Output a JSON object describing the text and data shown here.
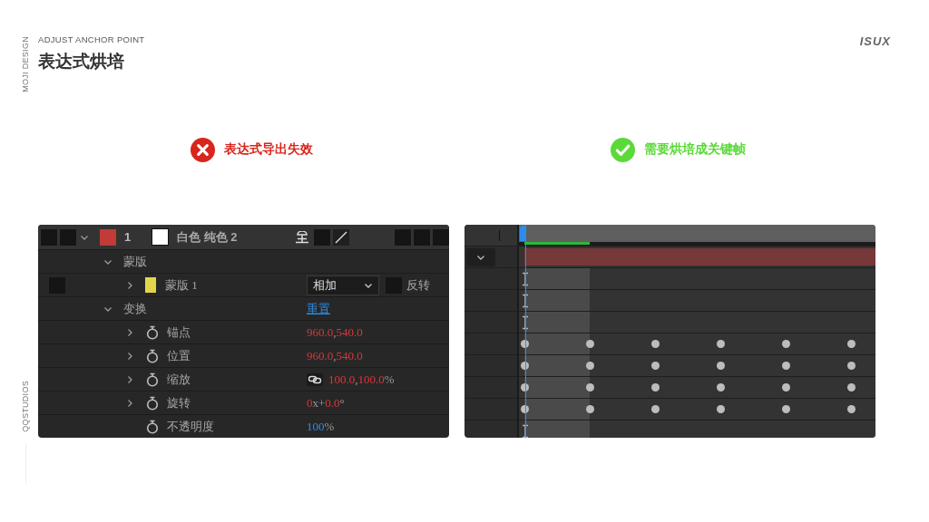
{
  "rail": {
    "top_label": "MOJI DESIGN",
    "bottom_label": "QQSTUDIOS"
  },
  "header": {
    "subtitle": "ADJUST ANCHOR POINT",
    "title": "表达式烘培",
    "brand": "ISUX"
  },
  "captions": [
    {
      "kind": "error",
      "text": "表达式导出失效"
    },
    {
      "kind": "success",
      "text": "需要烘培成关键帧"
    }
  ],
  "layer_panel": {
    "rows": [
      {
        "kind": "layer",
        "index": "1",
        "name": "白色 纯色 2",
        "color": "#c23b37",
        "expanded": true,
        "children": [
          {
            "kind": "group",
            "name": "蒙版",
            "expanded": true,
            "children": [
              {
                "kind": "mask",
                "name": "蒙版 1",
                "color": "#e3d54a",
                "expanded": false,
                "mode": "相加",
                "invert_label": "反转",
                "inverted": false
              }
            ]
          },
          {
            "kind": "group",
            "name": "变换",
            "expanded": true,
            "action": "重置",
            "children": [
              {
                "kind": "property",
                "name": "锚点",
                "expanded": false,
                "value": "960.0,540.0",
                "expression": true,
                "linked": false
              },
              {
                "kind": "property",
                "name": "位置",
                "expanded": false,
                "value": "960.0,540.0",
                "expression": true,
                "linked": false
              },
              {
                "kind": "property",
                "name": "缩放",
                "expanded": false,
                "value": "100.0,100.0%",
                "expression": true,
                "linked": true
              },
              {
                "kind": "property",
                "name": "旋转",
                "expanded": false,
                "value": "0x+0.0°",
                "expression": true,
                "linked": false
              },
              {
                "kind": "property",
                "name": "不透明度",
                "value": "100%",
                "expression": false,
                "linked": false
              }
            ]
          }
        ]
      }
    ]
  },
  "timeline": {
    "rows": [
      {
        "kind": "layer-bar"
      },
      {
        "kind": "static"
      },
      {
        "kind": "static"
      },
      {
        "kind": "static"
      },
      {
        "kind": "keyframes"
      },
      {
        "kind": "keyframes"
      },
      {
        "kind": "keyframes"
      },
      {
        "kind": "keyframes"
      },
      {
        "kind": "static"
      }
    ]
  }
}
